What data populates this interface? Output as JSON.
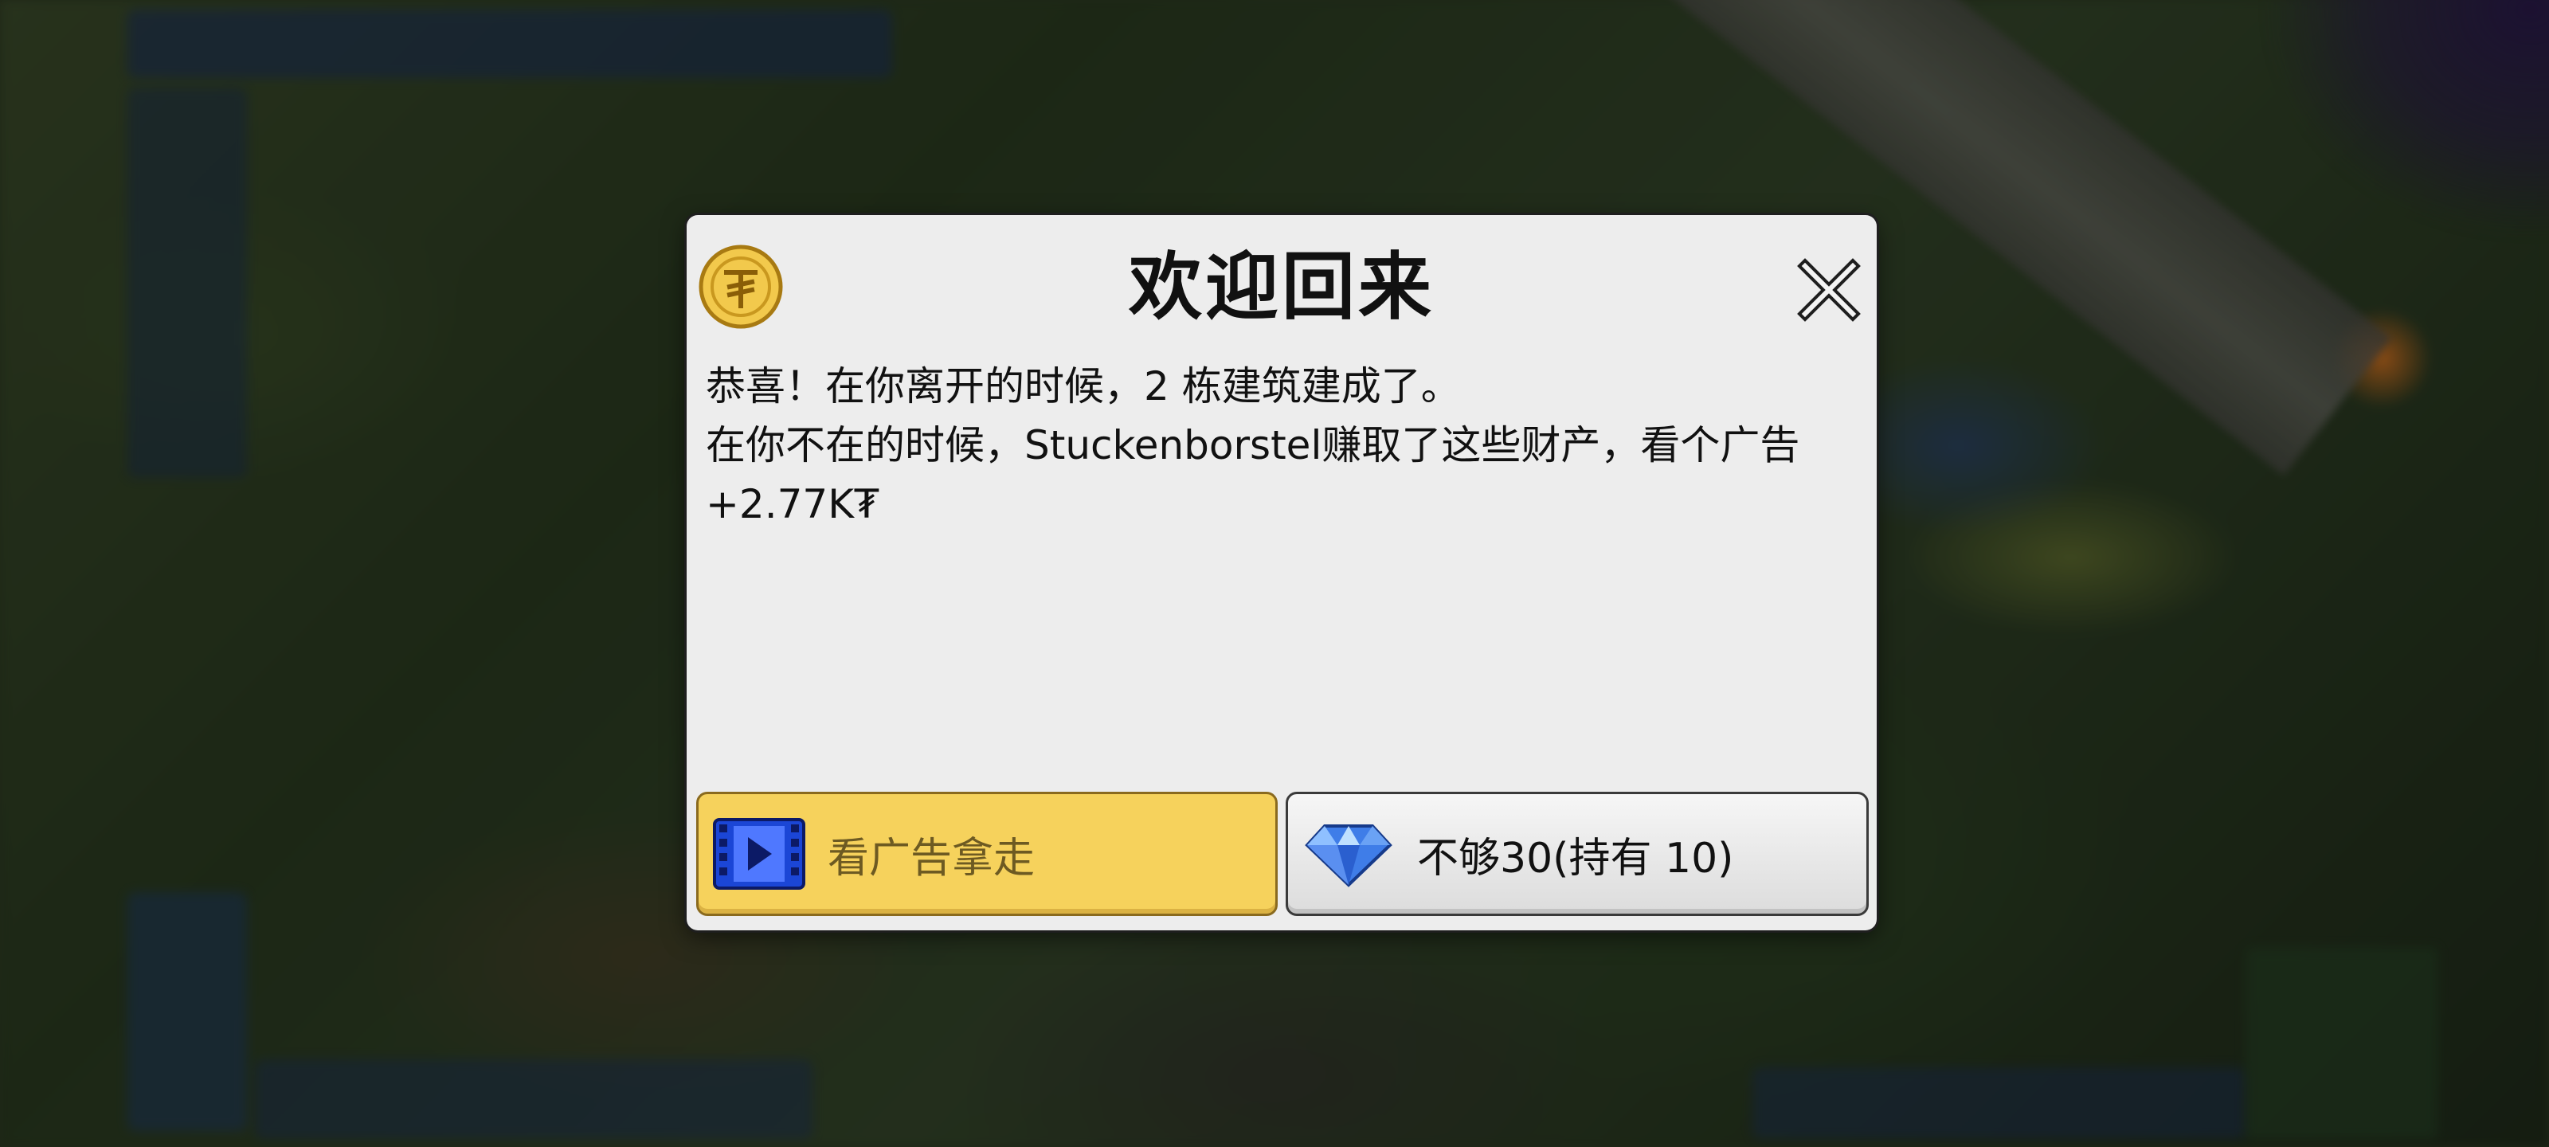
{
  "dialog": {
    "title": "欢迎回来",
    "message_lines": [
      "恭喜！在你离开的时候，2 栋建筑建成了。",
      "在你不在的时候，Stuckenborstel赚取了这些财产，看个广告",
      "+2.77K₮"
    ],
    "icons": {
      "header": "coin-icon",
      "close": "close-icon",
      "watch_ad": "video-play-icon",
      "gem": "diamond-icon"
    },
    "buttons": {
      "watch_ad_label": "看广告拿走",
      "gem_label": "不够30(持有 10)"
    }
  },
  "colors": {
    "dialog_bg": "#ededed",
    "ad_button": "#f6d25c",
    "ad_label": "#6d5a22",
    "coin": "#f2c94c",
    "gem": "#3f7de8",
    "video_icon": "#1b46d6"
  }
}
